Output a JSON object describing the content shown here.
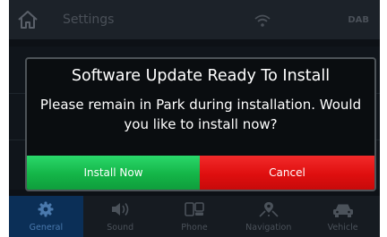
{
  "header": {
    "title": "Settings",
    "badge": "DAB",
    "home_icon": "home-icon",
    "wifi_icon": "wifi-icon"
  },
  "dialog": {
    "title": "Software Update Ready To Install",
    "message": "Please remain in Park during installation. Would you like to install now?",
    "install_label": "Install Now",
    "cancel_label": "Cancel"
  },
  "tabs": [
    {
      "label": "General",
      "icon": "gear-icon",
      "active": true
    },
    {
      "label": "Sound",
      "icon": "speaker-icon",
      "active": false
    },
    {
      "label": "Phone",
      "icon": "phone-icon",
      "active": false
    },
    {
      "label": "Navigation",
      "icon": "navigation-icon",
      "active": false
    },
    {
      "label": "Vehicle",
      "icon": "car-icon",
      "active": false
    }
  ],
  "colors": {
    "install": "#17b84b",
    "cancel": "#e01010",
    "active_tab": "#0b2f57"
  }
}
